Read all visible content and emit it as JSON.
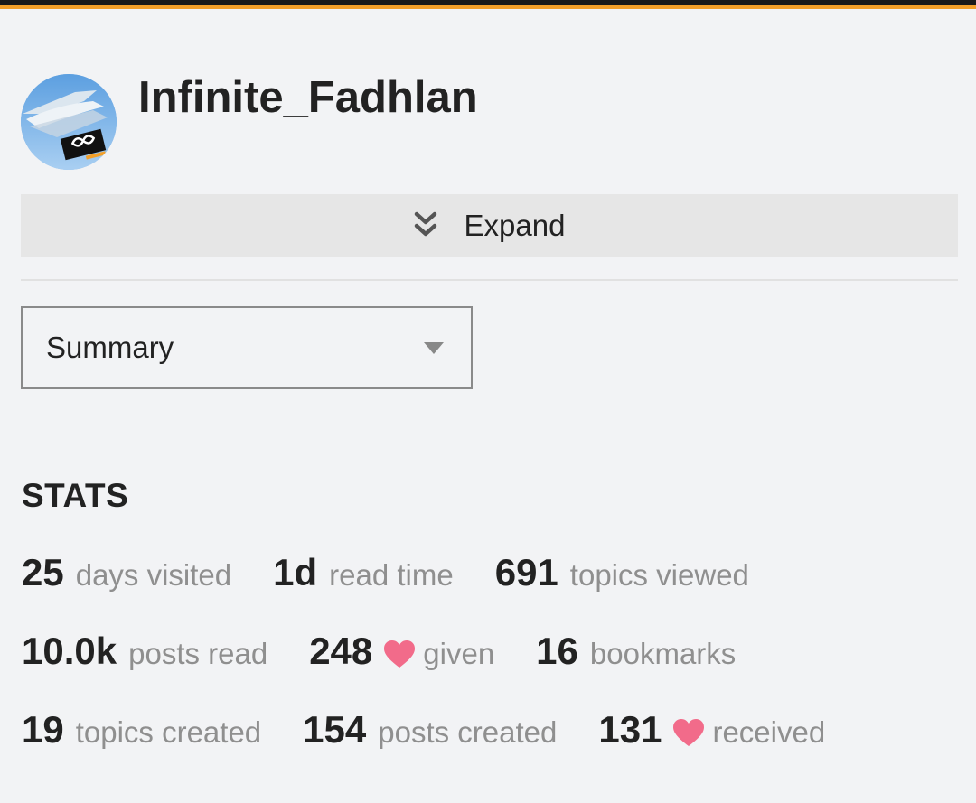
{
  "profile": {
    "username": "Infinite_Fadhlan"
  },
  "expand": {
    "label": "Expand",
    "icon": "double-chevron-down-icon"
  },
  "filter": {
    "selected": "Summary"
  },
  "stats": {
    "heading": "STATS",
    "rows": [
      [
        {
          "num": "25",
          "label": "days visited"
        },
        {
          "num": "1d",
          "label": "read time"
        },
        {
          "num": "691",
          "label": "topics viewed"
        }
      ],
      [
        {
          "num": "10.0k",
          "label": "posts read"
        },
        {
          "num": "248",
          "label": "given",
          "icon": "heart-icon"
        },
        {
          "num": "16",
          "label": "bookmarks"
        }
      ],
      [
        {
          "num": "19",
          "label": "topics created"
        },
        {
          "num": "154",
          "label": "posts created"
        },
        {
          "num": "131",
          "label": "received",
          "icon": "heart-icon"
        }
      ]
    ]
  },
  "colors": {
    "accent": "#f3a02a",
    "heart": "#f26b8a",
    "background": "#f2f3f5",
    "muted_text": "#8f8f8f"
  }
}
